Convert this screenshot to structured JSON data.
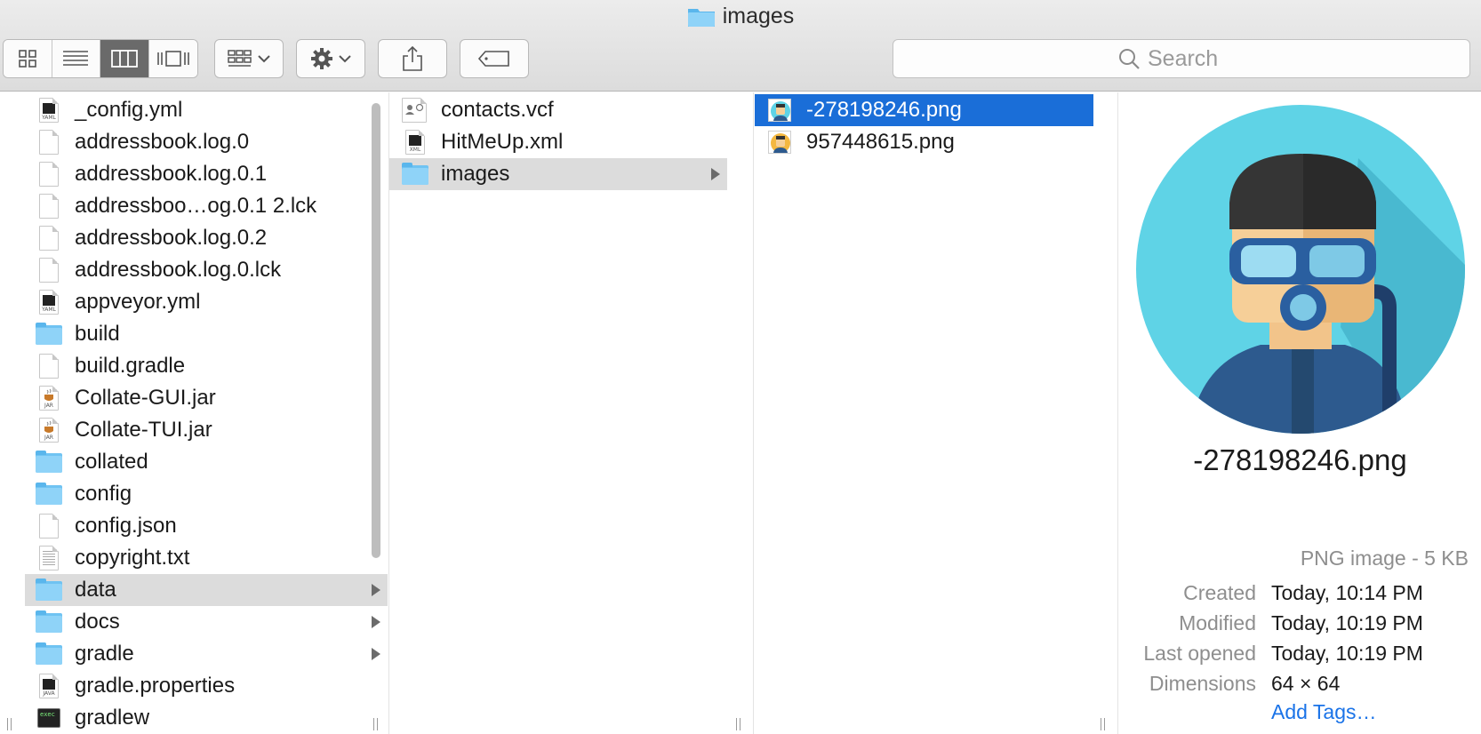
{
  "window": {
    "title": "images"
  },
  "toolbar": {
    "view_buttons": [
      {
        "icon": "icon-view-icon"
      },
      {
        "icon": "list-view-icon"
      },
      {
        "icon": "column-view-icon",
        "active": true
      },
      {
        "icon": "cover-flow-view-icon"
      }
    ],
    "arrange_icon": "group-arrange-icon",
    "action_icon": "gear-icon",
    "share_icon": "share-icon",
    "tag_icon": "tag-icon"
  },
  "search": {
    "placeholder": "Search"
  },
  "column1": {
    "items": [
      {
        "name": "_config.yml",
        "kind": "doc",
        "tag": "YAML"
      },
      {
        "name": "addressbook.log.0",
        "kind": "blank"
      },
      {
        "name": "addressbook.log.0.1",
        "kind": "blank"
      },
      {
        "name": "addressboo…og.0.1 2.lck",
        "kind": "blank"
      },
      {
        "name": "addressbook.log.0.2",
        "kind": "blank"
      },
      {
        "name": "addressbook.log.0.lck",
        "kind": "blank"
      },
      {
        "name": "appveyor.yml",
        "kind": "doc",
        "tag": "YAML"
      },
      {
        "name": "build",
        "kind": "folder"
      },
      {
        "name": "build.gradle",
        "kind": "blank"
      },
      {
        "name": "Collate-GUI.jar",
        "kind": "jar",
        "tag": "JAR"
      },
      {
        "name": "Collate-TUI.jar",
        "kind": "jar",
        "tag": "JAR"
      },
      {
        "name": "collated",
        "kind": "folder"
      },
      {
        "name": "config",
        "kind": "folder"
      },
      {
        "name": "config.json",
        "kind": "blank"
      },
      {
        "name": "copyright.txt",
        "kind": "text"
      },
      {
        "name": "data",
        "kind": "folder",
        "selected": true
      },
      {
        "name": "docs",
        "kind": "folder"
      },
      {
        "name": "gradle",
        "kind": "folder"
      },
      {
        "name": "gradle.properties",
        "kind": "doc",
        "tag": "JAVA"
      },
      {
        "name": "gradlew",
        "kind": "exec"
      }
    ]
  },
  "column2": {
    "items": [
      {
        "name": "contacts.vcf",
        "kind": "vcard"
      },
      {
        "name": "HitMeUp.xml",
        "kind": "doc",
        "tag": "XML"
      },
      {
        "name": "images",
        "kind": "folder",
        "selected": true
      }
    ]
  },
  "column3": {
    "items": [
      {
        "name": "-278198246.png",
        "kind": "image",
        "selected": true
      },
      {
        "name": "957448615.png",
        "kind": "image"
      }
    ]
  },
  "preview": {
    "filename": "-278198246.png",
    "kind": "PNG image - 5 KB",
    "meta": [
      {
        "label": "Created",
        "value": "Today, 10:14 PM"
      },
      {
        "label": "Modified",
        "value": "Today, 10:19 PM"
      },
      {
        "label": "Last opened",
        "value": "Today, 10:19 PM"
      },
      {
        "label": "Dimensions",
        "value": "64 × 64"
      }
    ],
    "add_tags": "Add Tags…"
  },
  "colors": {
    "selection": "#1a6ed8",
    "folder": "#6fc3f2",
    "link": "#1a73e8"
  }
}
